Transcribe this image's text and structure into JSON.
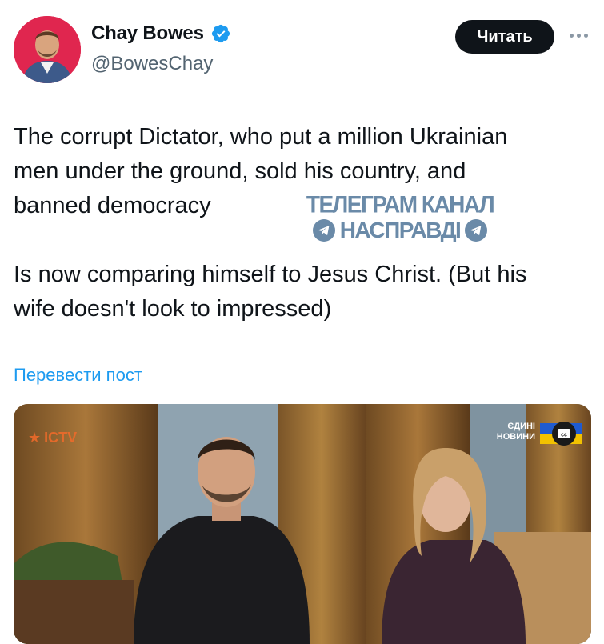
{
  "author": {
    "name": "Chay Bowes",
    "handle": "@BowesChay",
    "verified": true,
    "avatar_icon": "profile-photo"
  },
  "follow_button": {
    "label": "Читать"
  },
  "more_icon": "more-options-icon",
  "tweet": {
    "lines": [
      "The corrupt Dictator, who put a million Ukrainian",
      "men under the ground, sold his country, and",
      "banned democracy"
    ],
    "lines2": [
      "Is now comparing himself to Jesus Christ. (But his",
      "wife doesn't look to impressed)"
    ]
  },
  "watermark": {
    "line1": "ТЕЛЕГРАМ КАНАЛ",
    "line2": "НАСПРАВДІ"
  },
  "translate_link": "Перевести пост",
  "media": {
    "channel_logo": "ICTV",
    "news_label_line1": "ЄДИНІ",
    "news_label_line2": "НОВИНИ",
    "badge": "cc"
  },
  "colors": {
    "accent": "#1d9bf0",
    "text": "#0f1419",
    "secondary": "#536471",
    "button_bg": "#0f1419"
  }
}
